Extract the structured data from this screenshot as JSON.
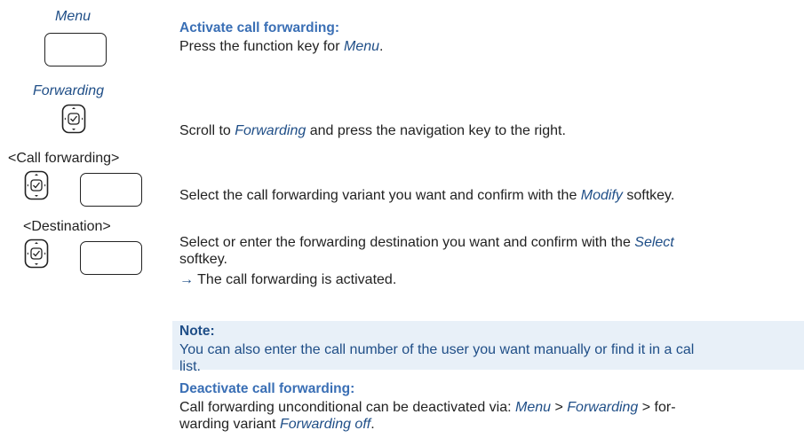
{
  "left": {
    "menu_label": "Menu",
    "forwarding_label": "Forwarding",
    "call_forwarding_label": "<Call forwarding>",
    "destination_label": "<Destination>"
  },
  "step1": {
    "heading": "Activate call forwarding:",
    "text_pre": "Press the function key for ",
    "text_hl": "Menu",
    "text_post": "."
  },
  "step2": {
    "text_pre": "Scroll to ",
    "text_hl": "Forwarding",
    "text_post": " and press the navigation key to the right."
  },
  "step3": {
    "text_pre": "Select the call forwarding variant you want and confirm with the ",
    "text_hl": "Modify",
    "text_post": " softkey."
  },
  "step4": {
    "text_pre": "Select or enter the forwarding destination you want and confirm with the ",
    "text_hl": "Select",
    "line2": "softkey.",
    "result_arrow": "→",
    "result_text": "The call forwarding is activated."
  },
  "note": {
    "title": "Note:",
    "line1": "You can also enter the call number of the user you want manually or find it in a cal",
    "line2": "list."
  },
  "deactivate": {
    "heading": "Deactivate call forwarding:",
    "line1_pre": "Call forwarding unconditional can be deactivated via: ",
    "menu": "Menu",
    "sep1": " > ",
    "forwarding": "Forwarding",
    "sep2": " > for-",
    "line2_pre": "warding variant ",
    "forwarding_off": "Forwarding off",
    "line2_post": "."
  }
}
